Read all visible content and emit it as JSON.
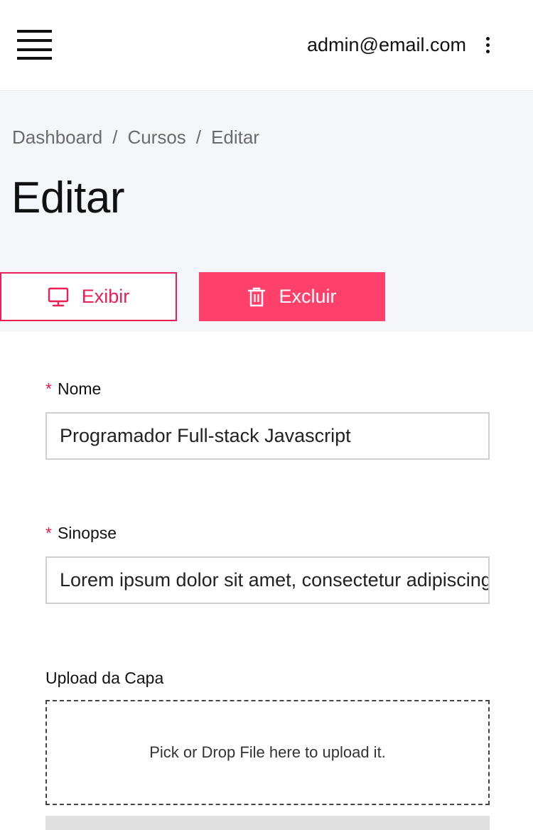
{
  "topbar": {
    "user_email": "admin@email.com",
    "menu_icon": "hamburger-menu-icon",
    "more_icon": "more-vertical-icon"
  },
  "breadcrumb": {
    "items": [
      "Dashboard",
      "Cursos",
      "Editar"
    ],
    "separator": "/"
  },
  "page": {
    "title": "Editar"
  },
  "actions": {
    "show_label": "Exibir",
    "show_icon": "monitor-icon",
    "delete_label": "Excluir",
    "delete_icon": "trash-icon"
  },
  "form": {
    "required_marker": "*",
    "name": {
      "label": "Nome",
      "value": "Programador Full-stack Javascript"
    },
    "synopsis": {
      "label": "Sinopse",
      "value": "Lorem ipsum dolor sit amet, consectetur adipiscing elit"
    },
    "cover": {
      "label": "Upload da Capa",
      "dropzone_text": "Pick or Drop File here to upload it."
    }
  },
  "colors": {
    "accent": "#ec1e55",
    "danger_button": "#ff406a",
    "header_background": "#f5f6fa"
  }
}
